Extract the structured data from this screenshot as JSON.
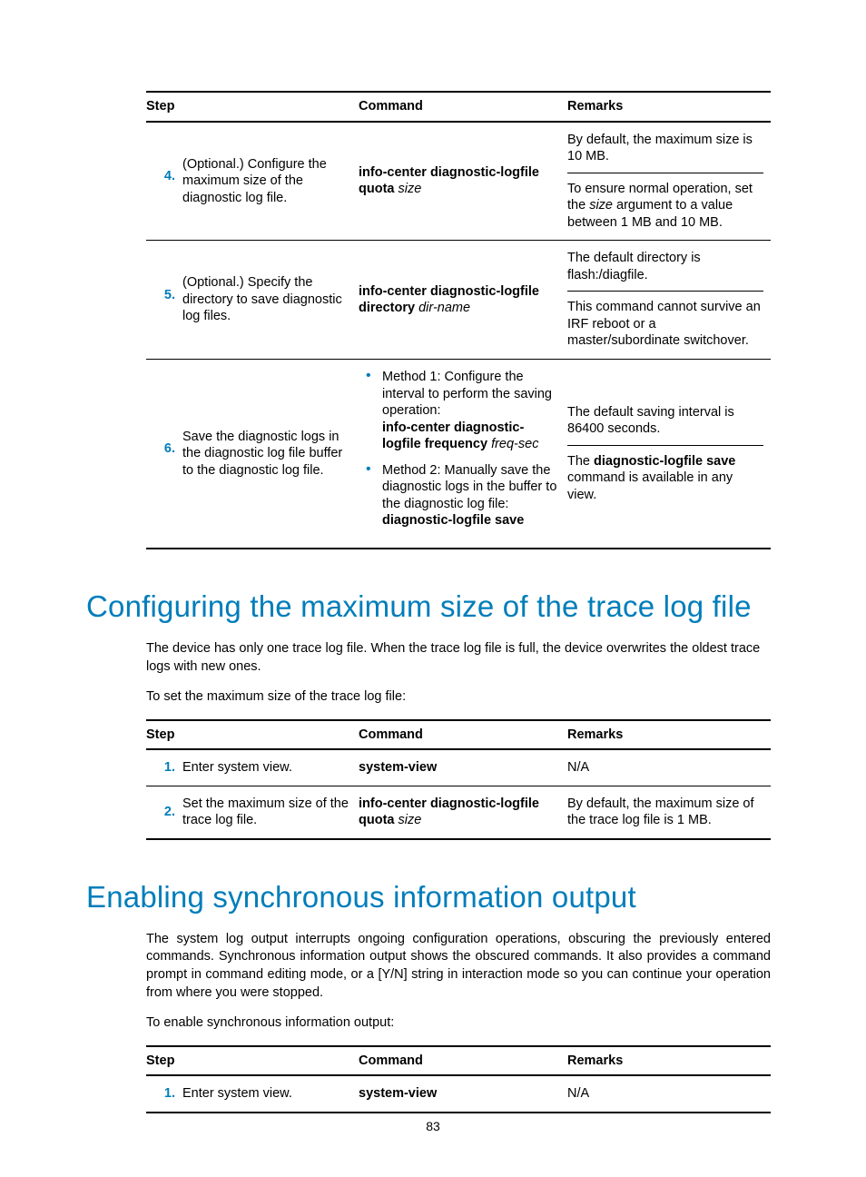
{
  "page_number": "83",
  "headers": {
    "step": "Step",
    "command": "Command",
    "remarks": "Remarks"
  },
  "table1": {
    "rows": [
      {
        "num": "4.",
        "desc": "(Optional.) Configure the maximum size of the diagnostic log file.",
        "cmd_bold": "info-center diagnostic-logfile quota",
        "cmd_ital": "size",
        "rem1": "By default, the maximum size is 10 MB.",
        "rem2_a": "To ensure normal operation, set the ",
        "rem2_ital": "size",
        "rem2_b": " argument to a value between 1 MB and 10 MB."
      },
      {
        "num": "5.",
        "desc": "(Optional.) Specify the directory to save diagnostic log files.",
        "cmd_bold": "info-center diagnostic-logfile directory",
        "cmd_ital": "dir-name",
        "rem1": "The default directory is flash:/diagfile.",
        "rem2": "This command cannot survive an IRF reboot or a master/subordinate switchover."
      },
      {
        "num": "6.",
        "desc": "Save the diagnostic logs in the diagnostic log file buffer to the diagnostic log file.",
        "m1_lead": "Method 1: Configure the interval to perform the saving operation:",
        "m1_bold": "info-center diagnostic-logfile frequency",
        "m1_ital": "freq-sec",
        "m2_lead": "Method 2: Manually save the diagnostic logs in the buffer to the diagnostic log file:",
        "m2_bold": "diagnostic-logfile save",
        "rem1": "The default saving interval is 86400 seconds.",
        "rem2_a": "The ",
        "rem2_bold": "diagnostic-logfile save",
        "rem2_b": " command is available in any view."
      }
    ]
  },
  "heading1": "Configuring the maximum size of the trace log file",
  "para1": "The device has only one trace log file. When the trace log file is full, the device overwrites the oldest trace logs with new ones.",
  "para2": "To set the maximum size of the trace log file:",
  "table2": {
    "rows": [
      {
        "num": "1.",
        "desc": "Enter system view.",
        "cmd_bold": "system-view",
        "rem": "N/A"
      },
      {
        "num": "2.",
        "desc": "Set the maximum size of the trace log file.",
        "cmd_bold": "info-center diagnostic-logfile quota",
        "cmd_ital": "size",
        "rem": "By default, the maximum size of the trace log file is 1 MB."
      }
    ]
  },
  "heading2": "Enabling synchronous information output",
  "para3": "The system log output interrupts ongoing configuration operations, obscuring the previously entered commands. Synchronous information output shows the obscured commands. It also provides a command prompt in command editing mode, or a [Y/N] string in interaction mode so you can continue your operation from where you were stopped.",
  "para4": "To enable synchronous information output:",
  "table3": {
    "rows": [
      {
        "num": "1.",
        "desc": "Enter system view.",
        "cmd_bold": "system-view",
        "rem": "N/A"
      }
    ]
  }
}
